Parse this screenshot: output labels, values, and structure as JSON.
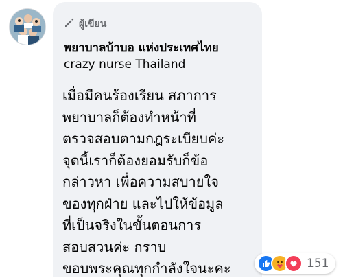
{
  "comment": {
    "badge_label": "ผู้เขียน",
    "author_bold": "พยาบาลบ้าบอ แห่งประเทศไทย",
    "author_rest": " crazy nurse Thailand",
    "lines": [
      "เมื่อมีคนร้องเรียน สภาการ",
      "พยาบาลก็ต้องทำหน้าที่",
      "ตรวจสอบตามกฎระเบียบค่ะ",
      "จุดนี้เราก็ต้องยอมรับก็ข้อ",
      "กล่าวหา เพื่อความสบายใจ",
      "ของทุกฝ่าย และไปให้ข้อมูล",
      "ที่เป็นจริงในขั้นตอนการ",
      "สอบสวนค่ะ กราบ",
      "ขอบพระคุณทุกกำลังใจนะคะ"
    ],
    "reactions": {
      "icons": [
        "like-icon",
        "care-icon",
        "love-icon"
      ],
      "count": "151"
    }
  },
  "colors": {
    "bubble_bg": "#f0f2f5",
    "like_blue": "#1877f2",
    "love_red": "#f33e58",
    "care_yellow": "#f7b125",
    "muted_text": "#65676b"
  }
}
